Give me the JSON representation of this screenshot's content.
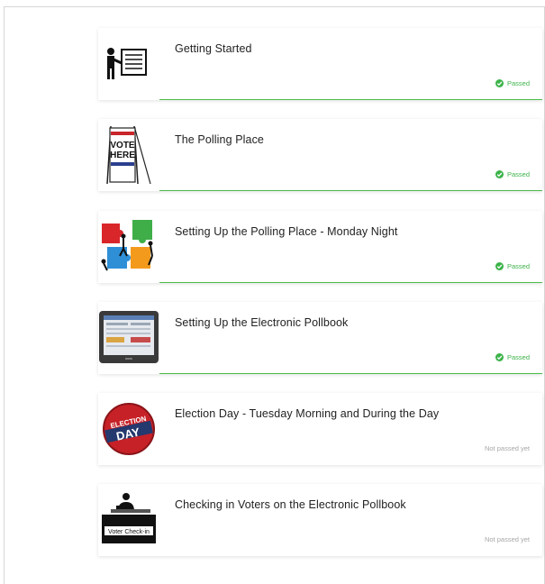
{
  "colors": {
    "passed": "#3cb34a",
    "not_passed": "#a7a7a7",
    "progress": "#4cbb4a"
  },
  "lessons": [
    {
      "title": "Getting Started",
      "status": "Passed",
      "passed": true,
      "icon": "presenter-board-icon"
    },
    {
      "title": "The Polling Place",
      "status": "Passed",
      "passed": true,
      "icon": "vote-here-sign-icon",
      "icon_text": [
        "VOTE",
        "HERE"
      ]
    },
    {
      "title": "Setting Up the Polling Place - Monday Night",
      "status": "Passed",
      "passed": true,
      "icon": "puzzle-team-icon"
    },
    {
      "title": "Setting Up the Electronic Pollbook",
      "status": "Passed",
      "passed": true,
      "icon": "tablet-pollbook-icon"
    },
    {
      "title": "Election Day - Tuesday Morning and During the Day",
      "status": "Not passed yet",
      "passed": false,
      "icon": "election-day-button-icon",
      "icon_text": [
        "ELECTION",
        "DAY"
      ]
    },
    {
      "title": "Checking in Voters on the Electronic Pollbook",
      "status": "Not passed yet",
      "passed": false,
      "icon": "voter-check-in-icon",
      "icon_text": [
        "Voter Check-in"
      ]
    }
  ]
}
